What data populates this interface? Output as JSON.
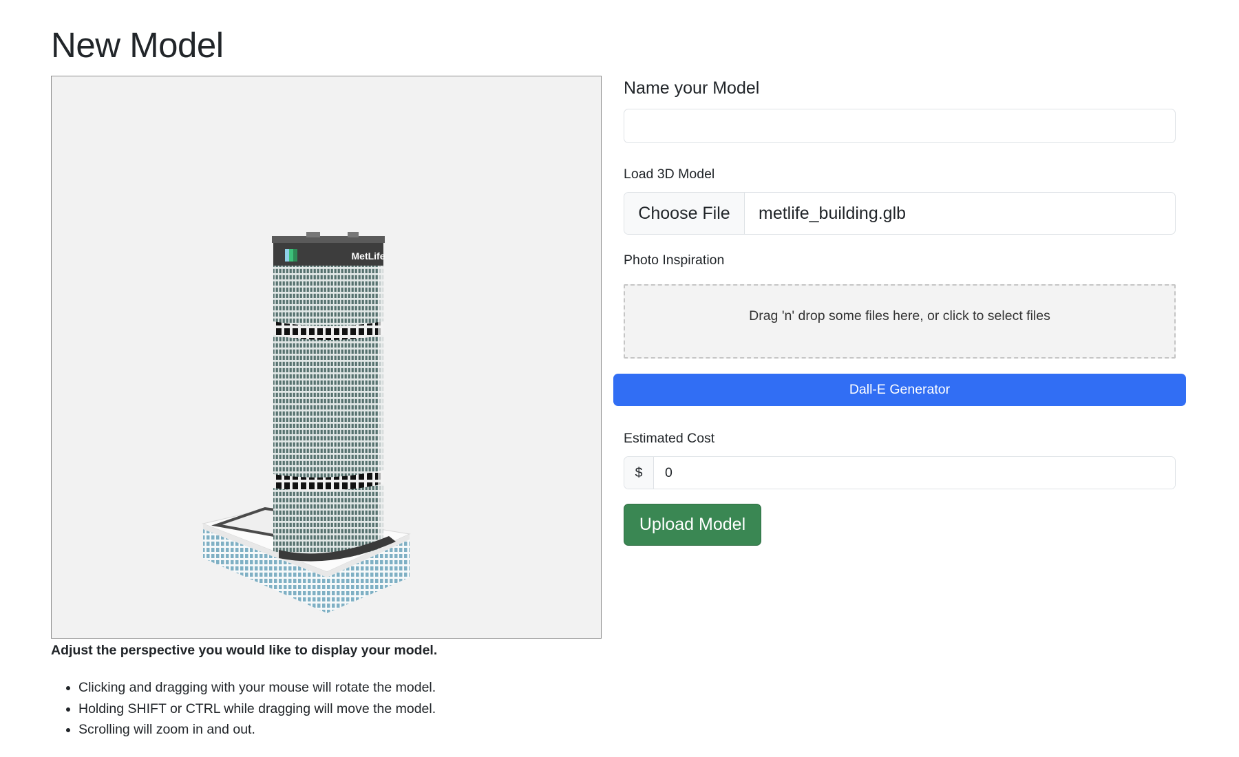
{
  "page": {
    "title": "New Model"
  },
  "viewer": {
    "model_sign_text": "MetLife",
    "instructions_heading": "Adjust the perspective you would like to display your model.",
    "instructions": [
      "Clicking and dragging with your mouse will rotate the model.",
      "Holding SHIFT or CTRL while dragging will move the model.",
      "Scrolling will zoom in and out."
    ]
  },
  "form": {
    "name_label": "Name your Model",
    "name_value": "",
    "model_label": "Load 3D Model",
    "choose_file_label": "Choose File",
    "file_name": "metlife_building.glb",
    "photo_label": "Photo Inspiration",
    "dropzone_text": "Drag 'n' drop some files here, or click to select files",
    "dalle_button_label": "Dall-E Generator",
    "cost_label": "Estimated Cost",
    "cost_prefix": "$",
    "cost_value": "0",
    "upload_button_label": "Upload Model"
  },
  "colors": {
    "primary": "#316ef4",
    "success": "#3a8753",
    "viewer_background": "#f2f2f2",
    "building_glass": "#5e7f7c",
    "podium_glass": "#7fb0c4"
  }
}
